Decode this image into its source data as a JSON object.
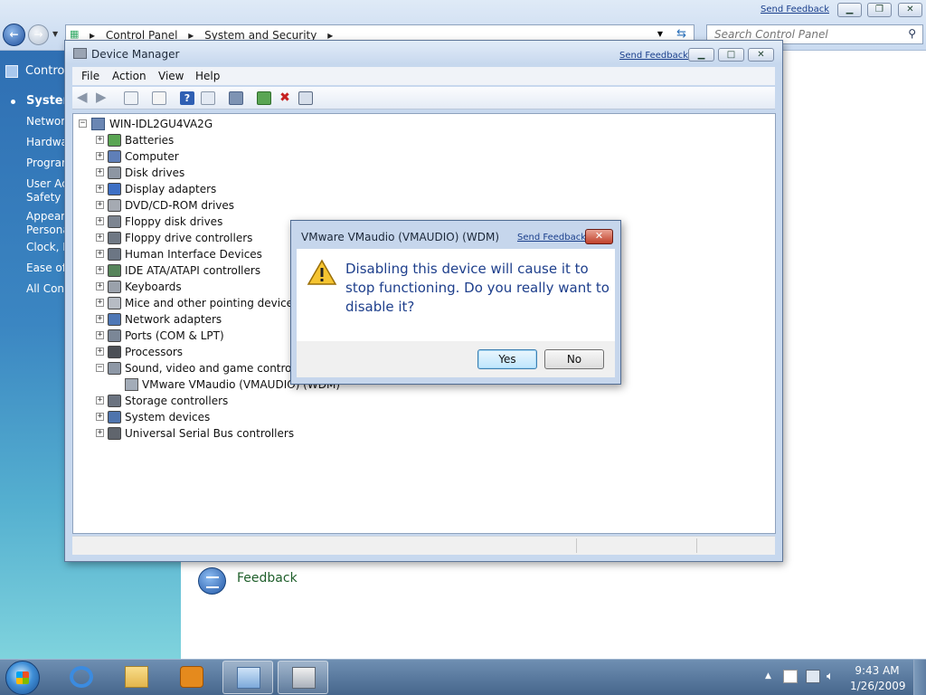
{
  "control_panel": {
    "send_feedback": "Send Feedback",
    "crumbs": [
      "Control Panel",
      "System and Security"
    ],
    "search_placeholder": "Search Control Panel",
    "sidebar_title": "Control",
    "sidebar_items": [
      "System",
      "Network",
      "Hardwa",
      "Program",
      "User Acc\nSafety",
      "Appeara\nPersona",
      "Clock, L",
      "Ease of A",
      "All Cont"
    ],
    "feedback_label": "Feedback"
  },
  "device_manager": {
    "title": "Device Manager",
    "send_feedback": "Send Feedback",
    "menu": [
      "File",
      "Action",
      "View",
      "Help"
    ],
    "tree": {
      "root": "WIN-IDL2GU4VA2G",
      "categories": [
        {
          "label": "Batteries",
          "icon": "battery-icon",
          "expanded": false
        },
        {
          "label": "Computer",
          "icon": "computer-icon",
          "expanded": false
        },
        {
          "label": "Disk drives",
          "icon": "disk-drive-icon",
          "expanded": false
        },
        {
          "label": "Display adapters",
          "icon": "display-adapter-icon",
          "expanded": false
        },
        {
          "label": "DVD/CD-ROM drives",
          "icon": "dvd-drive-icon",
          "expanded": false
        },
        {
          "label": "Floppy disk drives",
          "icon": "floppy-disk-icon",
          "expanded": false
        },
        {
          "label": "Floppy drive controllers",
          "icon": "floppy-controller-icon",
          "expanded": false
        },
        {
          "label": "Human Interface Devices",
          "icon": "hid-icon",
          "expanded": false
        },
        {
          "label": "IDE ATA/ATAPI controllers",
          "icon": "ide-controller-icon",
          "expanded": false
        },
        {
          "label": "Keyboards",
          "icon": "keyboard-icon",
          "expanded": false
        },
        {
          "label": "Mice and other pointing devices",
          "icon": "mouse-icon",
          "expanded": false
        },
        {
          "label": "Network adapters",
          "icon": "network-adapter-icon",
          "expanded": false
        },
        {
          "label": "Ports (COM & LPT)",
          "icon": "port-icon",
          "expanded": false
        },
        {
          "label": "Processors",
          "icon": "processor-icon",
          "expanded": false
        },
        {
          "label": "Sound, video and game controllers",
          "icon": "sound-icon",
          "expanded": true,
          "children": [
            "VMware VMaudio (VMAUDIO) (WDM)"
          ]
        },
        {
          "label": "Storage controllers",
          "icon": "storage-controller-icon",
          "expanded": false
        },
        {
          "label": "System devices",
          "icon": "system-devices-icon",
          "expanded": false
        },
        {
          "label": "Universal Serial Bus controllers",
          "icon": "usb-icon",
          "expanded": false
        }
      ]
    }
  },
  "dialog": {
    "title": "VMware VMaudio (VMAUDIO) (WDM)",
    "send_feedback": "Send Feedback",
    "message": "Disabling this device will cause it to stop functioning. Do you really want to disable it?",
    "yes_label": "Yes",
    "no_label": "No"
  },
  "taskbar": {
    "time": "9:43 AM",
    "date": "1/26/2009"
  },
  "colors": {
    "link": "#1a3f8c",
    "dialog_text": "#1e3f8c",
    "feedback_green": "#1e5e2a",
    "sidebar_top": "#2f6fb3"
  }
}
